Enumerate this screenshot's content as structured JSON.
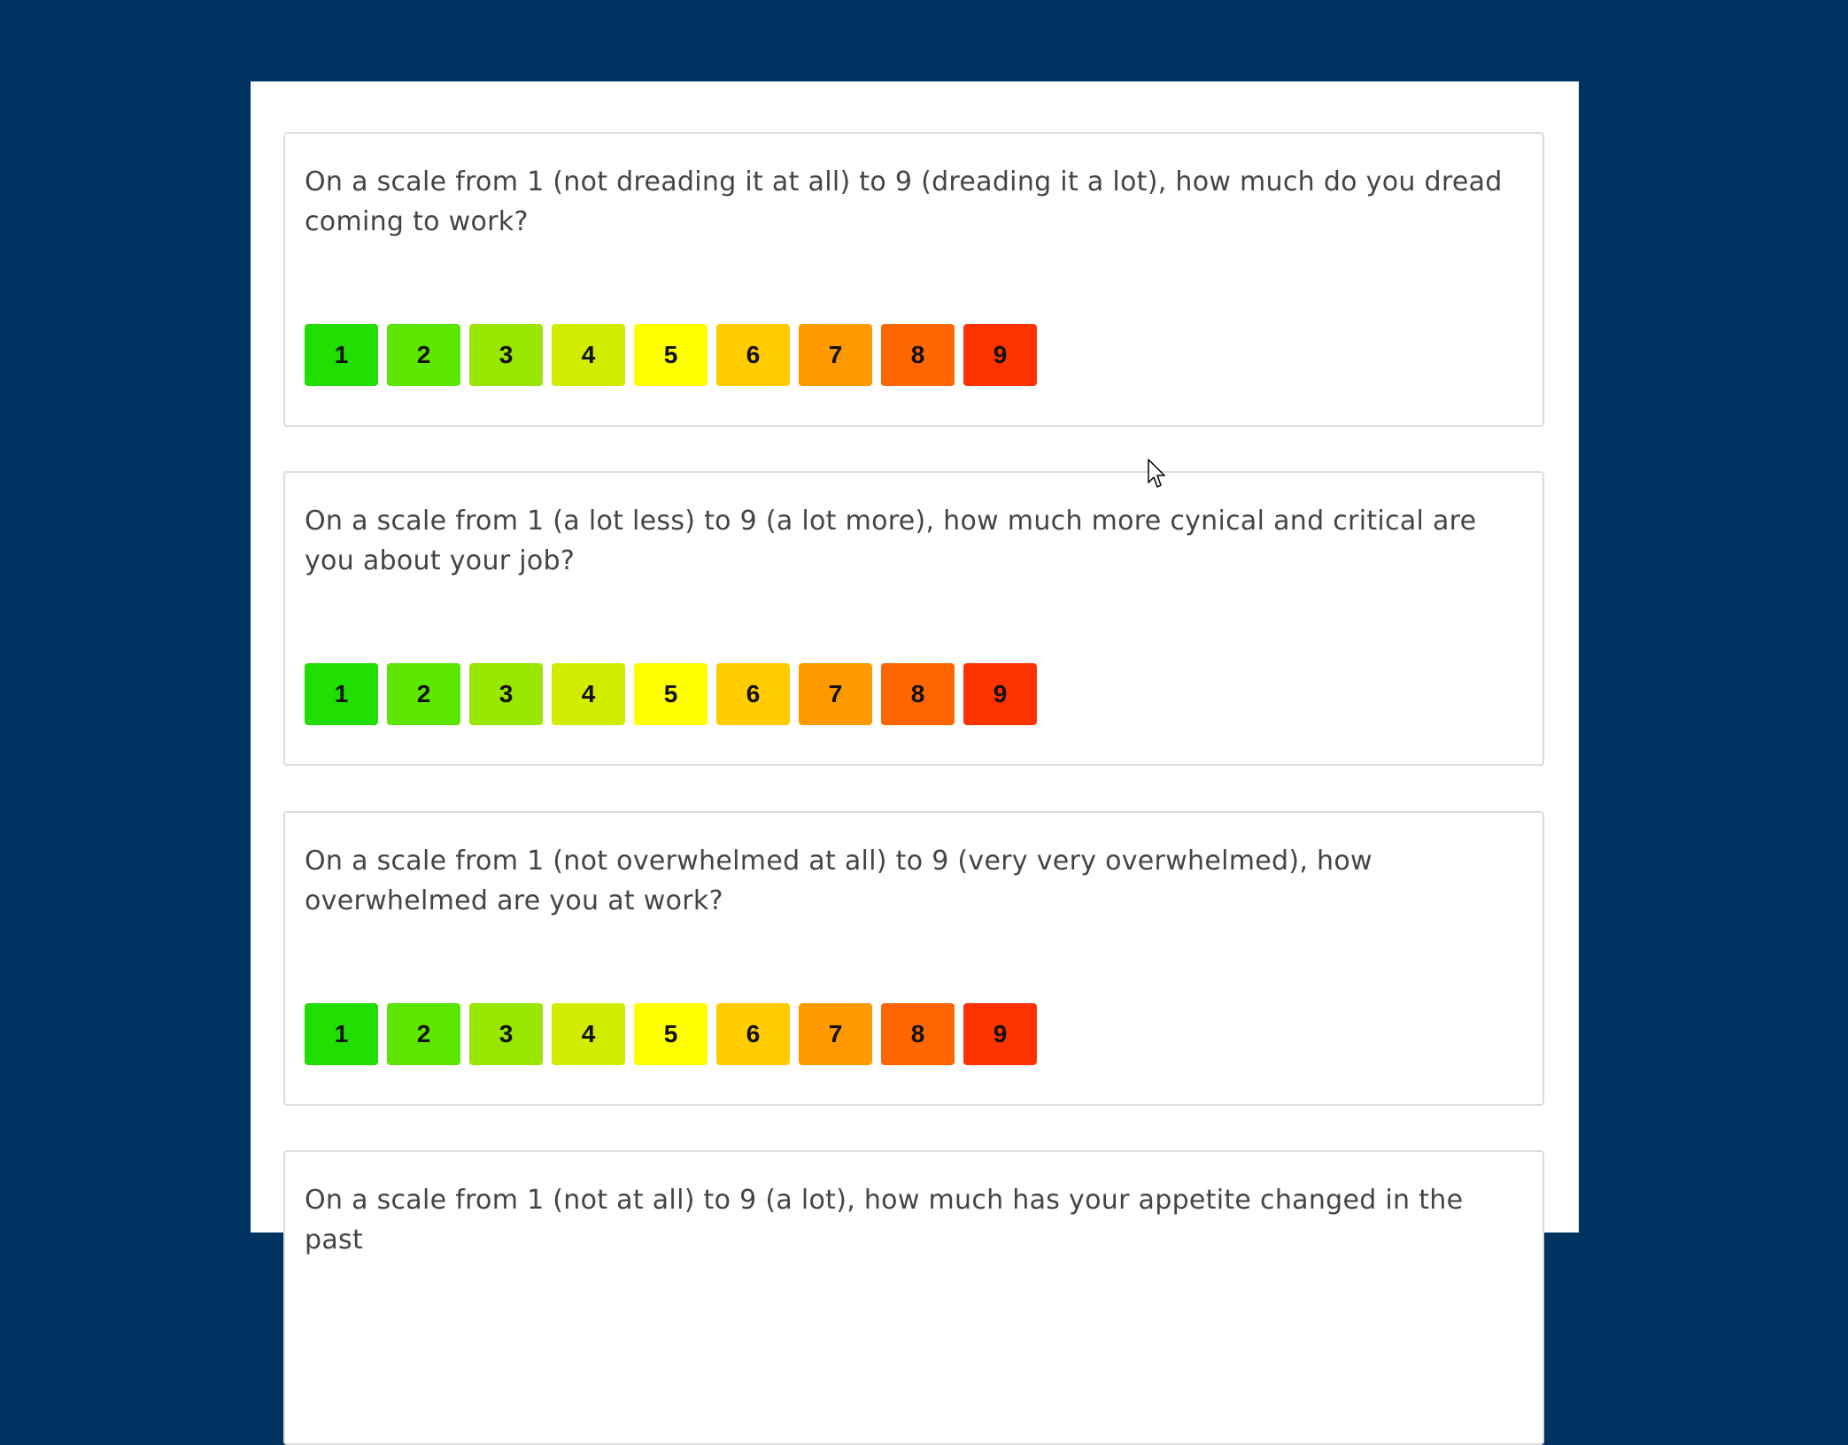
{
  "questions": [
    {
      "text": "On a scale from 1 (not dreading it at all) to 9 (dreading it a lot), how much do you dread coming to work?"
    },
    {
      "text": "On a scale from 1 (a lot less) to 9 (a lot more), how much more cynical and critical are you about your job?"
    },
    {
      "text": "On a scale from 1 (not overwhelmed at all) to 9 (very very overwhelmed), how overwhelmed are you at work?"
    },
    {
      "text": "On a scale from 1 (not at all) to 9 (a lot), how much has your appetite changed in the past"
    }
  ],
  "scale": {
    "labels": [
      "1",
      "2",
      "3",
      "4",
      "5",
      "6",
      "7",
      "8",
      "9"
    ],
    "colors": [
      "#22dd00",
      "#5ce600",
      "#99e600",
      "#d2ec00",
      "#ffff00",
      "#ffcc00",
      "#ff9900",
      "#ff6600",
      "#ff3300"
    ]
  },
  "cursor_icon": "arrow-pointer-icon"
}
